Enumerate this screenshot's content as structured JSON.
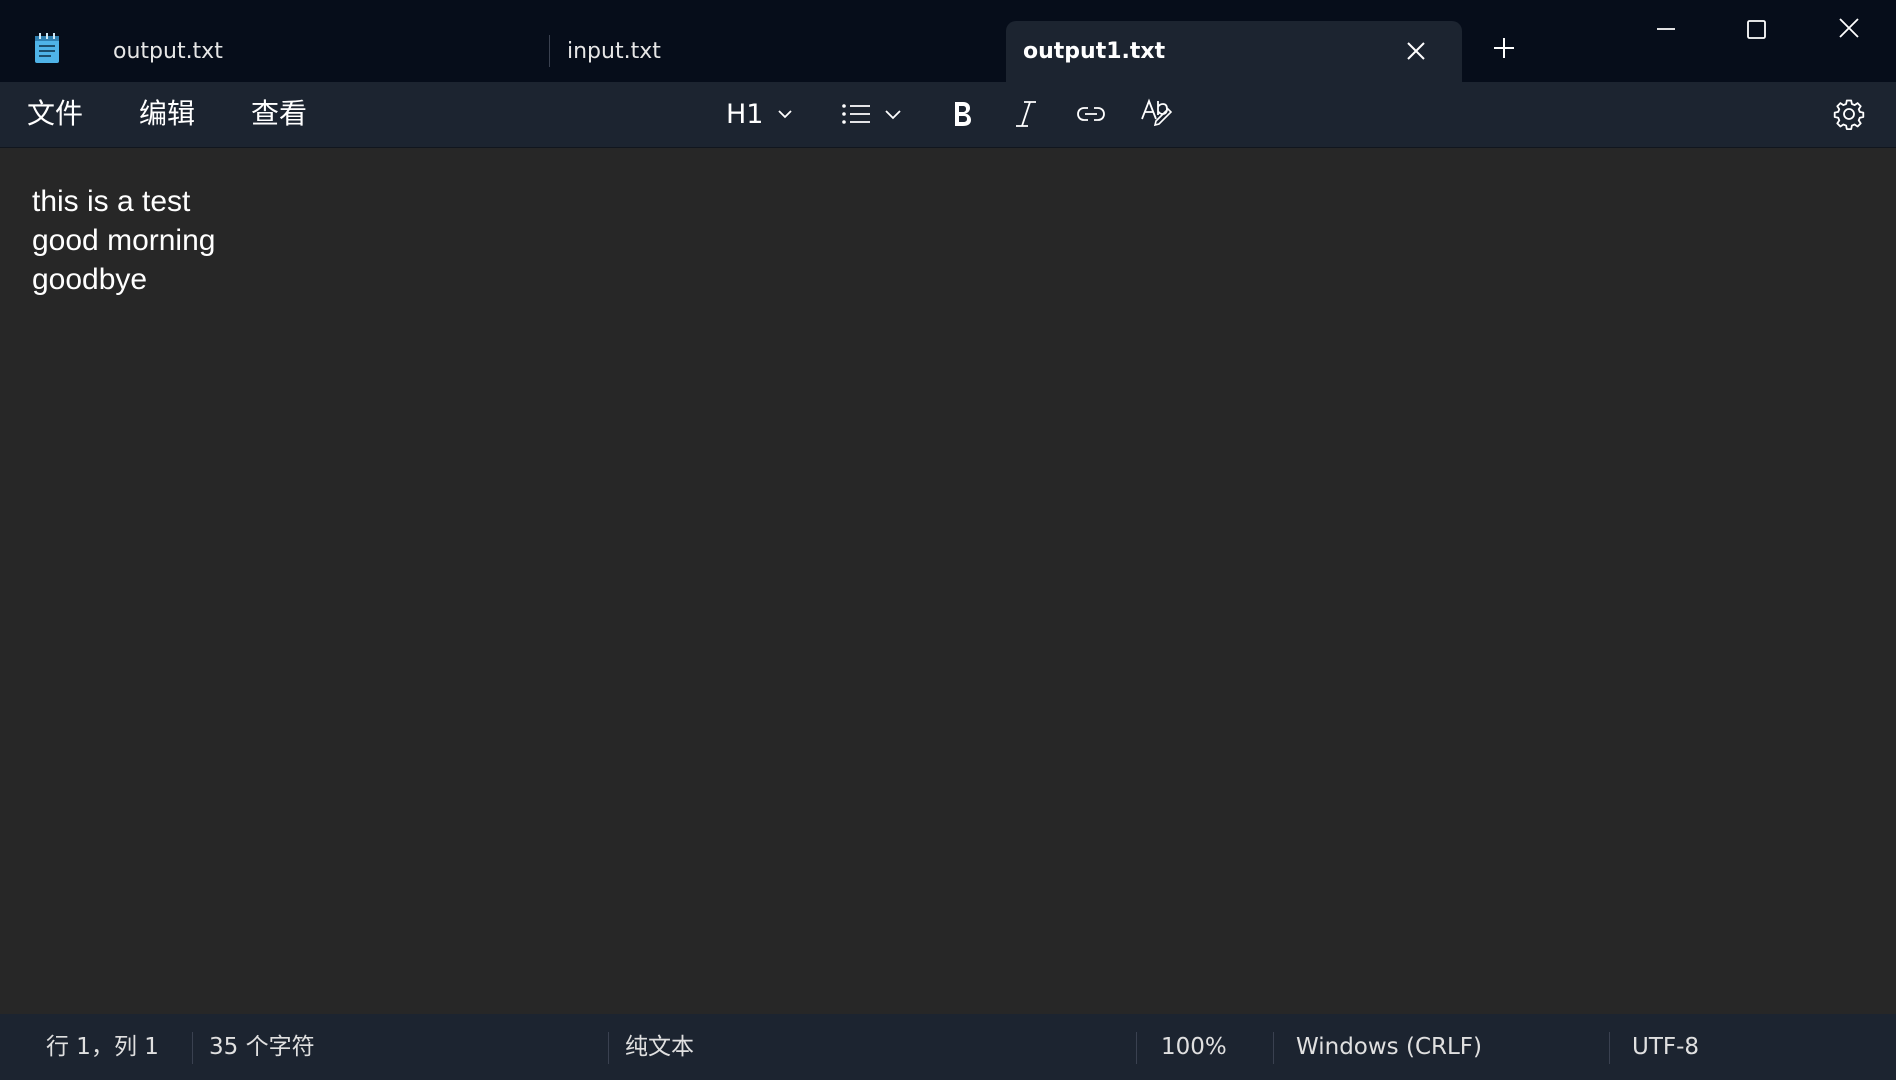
{
  "tabs": [
    {
      "label": "output.txt",
      "active": false
    },
    {
      "label": "input.txt",
      "active": false
    },
    {
      "label": "output1.txt",
      "active": true
    }
  ],
  "menu": {
    "file": "文件",
    "edit": "编辑",
    "view": "查看"
  },
  "toolbar": {
    "heading_value": "H1",
    "icons": [
      "list-icon",
      "bold-icon",
      "italic-icon",
      "link-icon",
      "spellcheck-icon",
      "gear-icon"
    ]
  },
  "editor": {
    "lines": [
      "this is a test",
      "good morning",
      "goodbye"
    ]
  },
  "status": {
    "position": "行 1，列 1",
    "char_count": "35 个字符",
    "format": "纯文本",
    "zoom": "100%",
    "line_ending": "Windows (CRLF)",
    "encoding": "UTF-8"
  },
  "colors": {
    "titlebar": "#060d1a",
    "toolbar": "#1c2430",
    "editor_bg": "#272727",
    "app_icon": "#4fb3e8"
  }
}
